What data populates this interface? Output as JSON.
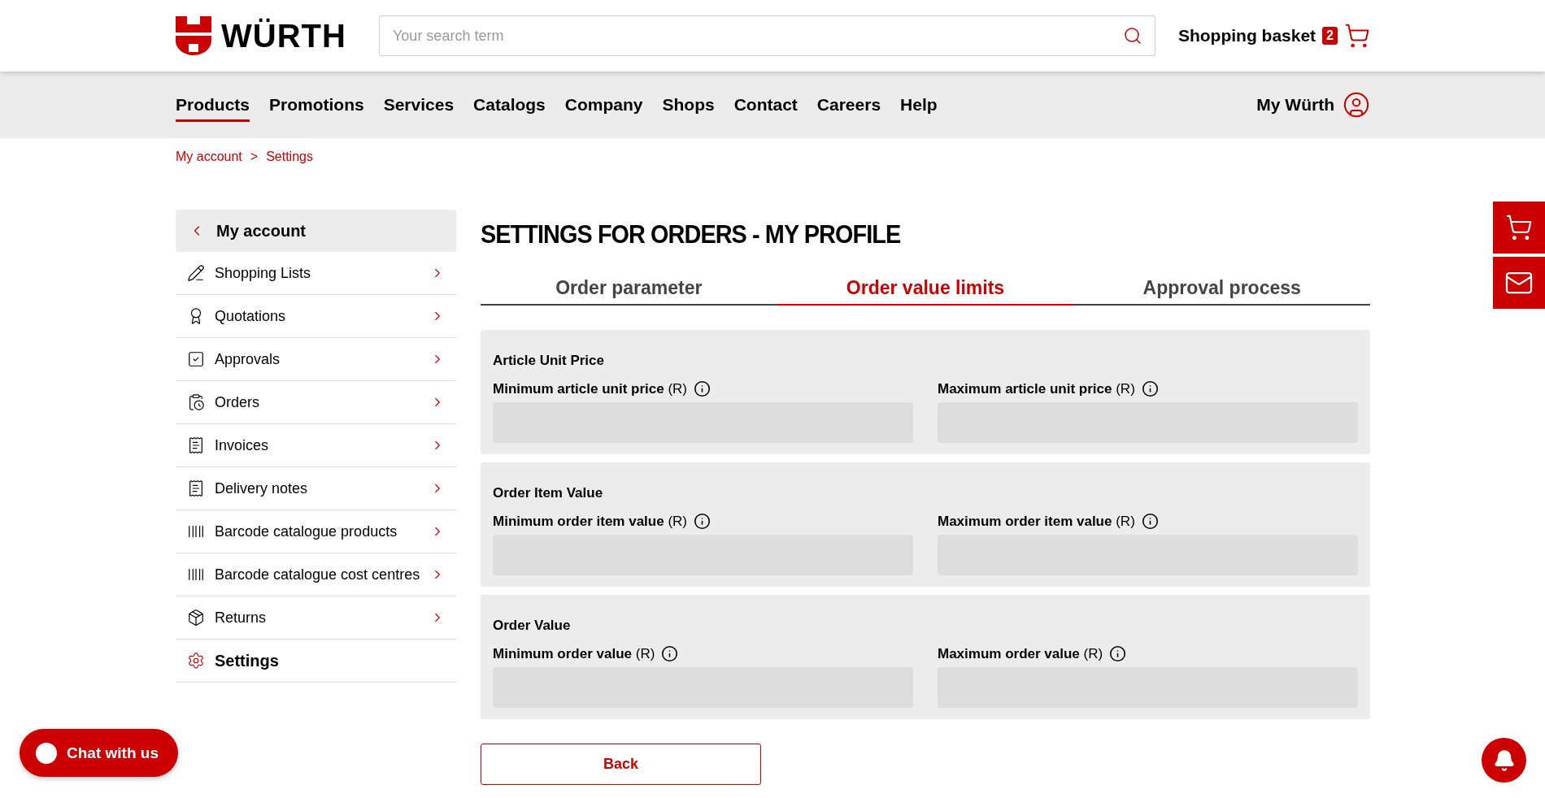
{
  "header": {
    "logo": "WÜRTH",
    "search": {
      "placeholder": "Your search term"
    },
    "basket": {
      "label": "Shopping basket",
      "count": "2"
    }
  },
  "nav": {
    "items": [
      {
        "label": "Products",
        "selected": true
      },
      {
        "label": "Promotions",
        "selected": false
      },
      {
        "label": "Services",
        "selected": false
      },
      {
        "label": "Catalogs",
        "selected": false
      },
      {
        "label": "Company",
        "selected": false
      },
      {
        "label": "Shops",
        "selected": false
      },
      {
        "label": "Contact",
        "selected": false
      },
      {
        "label": "Careers",
        "selected": false
      },
      {
        "label": "Help",
        "selected": false
      }
    ],
    "account": "My Würth"
  },
  "breadcrumb": {
    "items": [
      "My account",
      "Settings"
    ],
    "separator": ">"
  },
  "sidebar": {
    "back": "My account",
    "items": [
      {
        "label": "Shopping Lists",
        "kind": "pencil",
        "selected": false
      },
      {
        "label": "Quotations",
        "kind": "ribbon",
        "selected": false
      },
      {
        "label": "Approvals",
        "kind": "check",
        "selected": false
      },
      {
        "label": "Orders",
        "kind": "orders",
        "selected": false
      },
      {
        "label": "Invoices",
        "kind": "receipt",
        "selected": false
      },
      {
        "label": "Delivery notes",
        "kind": "receipt",
        "selected": false
      },
      {
        "label": "Barcode catalogue products",
        "kind": "barcode",
        "selected": false
      },
      {
        "label": "Barcode catalogue cost centres",
        "kind": "barcode",
        "selected": false
      },
      {
        "label": "Returns",
        "kind": "box",
        "selected": false
      },
      {
        "label": "Settings",
        "kind": "gear",
        "selected": true
      }
    ]
  },
  "main": {
    "title": "SETTINGS FOR ORDERS - MY PROFILE",
    "tabs": [
      {
        "label": "Order parameter",
        "selected": false
      },
      {
        "label": "Order value limits",
        "selected": true
      },
      {
        "label": "Approval process",
        "selected": false
      }
    ],
    "sections": [
      {
        "title": "Article Unit Price",
        "fields": [
          {
            "label": "Minimum article unit price",
            "unit": "(R)"
          },
          {
            "label": "Maximum article unit price",
            "unit": "(R)"
          }
        ]
      },
      {
        "title": "Order Item Value",
        "fields": [
          {
            "label": "Minimum order item value",
            "unit": "(R)"
          },
          {
            "label": "Maximum order item value",
            "unit": "(R)"
          }
        ]
      },
      {
        "title": "Order Value",
        "fields": [
          {
            "label": "Minimum order value",
            "unit": "(R)"
          },
          {
            "label": "Maximum order value",
            "unit": "(R)"
          }
        ]
      }
    ],
    "back_button": "Back"
  },
  "chat": {
    "label": "Chat with us"
  }
}
